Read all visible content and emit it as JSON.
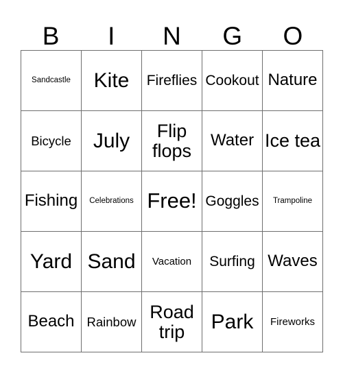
{
  "card": {
    "title_letters": [
      "B",
      "I",
      "N",
      "G",
      "O"
    ],
    "free_space_text": "Free!",
    "colors": {
      "background": "#ffffff",
      "text": "#000000",
      "grid_line": "#6e6e6e"
    },
    "grid": {
      "columns": 5,
      "rows": 5,
      "cells": [
        [
          {
            "text": "Sandcastle",
            "size": "xs"
          },
          {
            "text": "Kite",
            "size": "xxl"
          },
          {
            "text": "Fireflies",
            "size": "ml"
          },
          {
            "text": "Cookout",
            "size": "ml"
          },
          {
            "text": "Nature",
            "size": "l"
          }
        ],
        [
          {
            "text": "Bicycle",
            "size": "m"
          },
          {
            "text": "July",
            "size": "xxl"
          },
          {
            "text": "Flip flops",
            "size": "xl"
          },
          {
            "text": "Water",
            "size": "l"
          },
          {
            "text": "Ice tea",
            "size": "xl"
          }
        ],
        [
          {
            "text": "Fishing",
            "size": "l"
          },
          {
            "text": "Celebrations",
            "size": "xs"
          },
          {
            "text": "Free!",
            "size": "free"
          },
          {
            "text": "Goggles",
            "size": "ml"
          },
          {
            "text": "Trampoline",
            "size": "xs"
          }
        ],
        [
          {
            "text": "Yard",
            "size": "xxl"
          },
          {
            "text": "Sand",
            "size": "xxl"
          },
          {
            "text": "Vacation",
            "size": "s"
          },
          {
            "text": "Surfing",
            "size": "ml"
          },
          {
            "text": "Waves",
            "size": "l"
          }
        ],
        [
          {
            "text": "Beach",
            "size": "l"
          },
          {
            "text": "Rainbow",
            "size": "m"
          },
          {
            "text": "Road trip",
            "size": "xl"
          },
          {
            "text": "Park",
            "size": "xxl"
          },
          {
            "text": "Fireworks",
            "size": "s"
          }
        ]
      ]
    }
  }
}
